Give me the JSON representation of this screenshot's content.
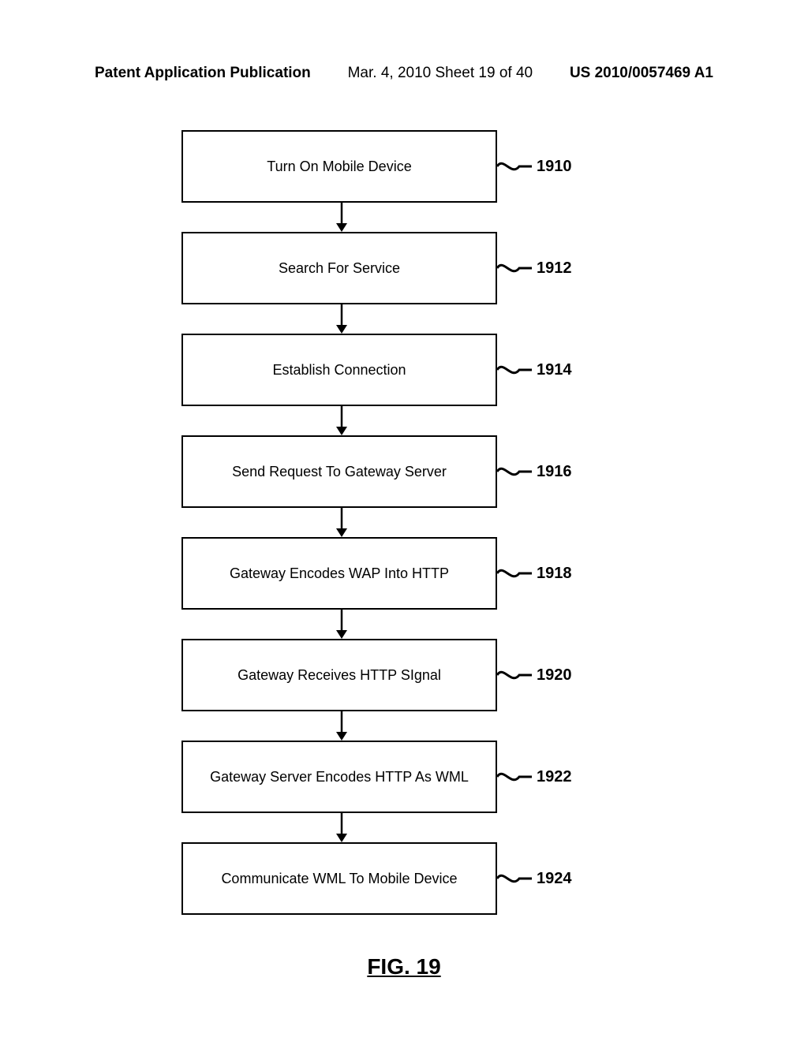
{
  "header": {
    "publication": "Patent Application Publication",
    "date_sheet": "Mar. 4, 2010  Sheet 19 of 40",
    "patent_number": "US 2010/0057469 A1"
  },
  "steps": [
    {
      "label": "Turn On Mobile Device",
      "ref": "1910"
    },
    {
      "label": "Search For Service",
      "ref": "1912"
    },
    {
      "label": "Establish Connection",
      "ref": "1914"
    },
    {
      "label": "Send Request To Gateway Server",
      "ref": "1916"
    },
    {
      "label": "Gateway Encodes WAP Into HTTP",
      "ref": "1918"
    },
    {
      "label": "Gateway Receives HTTP SIgnal",
      "ref": "1920"
    },
    {
      "label": "Gateway Server Encodes HTTP As WML",
      "ref": "1922"
    },
    {
      "label": "Communicate WML To Mobile Device",
      "ref": "1924"
    }
  ],
  "figure_title": "FIG. 19"
}
